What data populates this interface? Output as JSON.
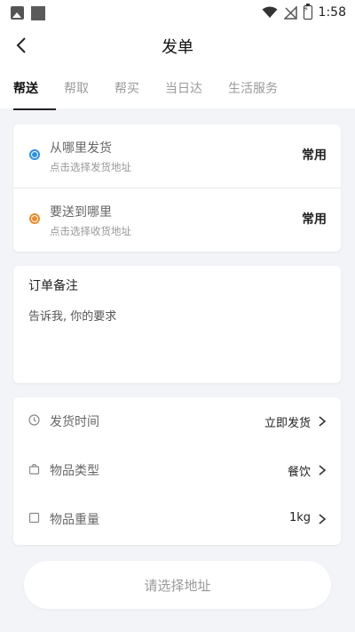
{
  "status_bar": {
    "time": "1:58"
  },
  "header": {
    "title": "发单"
  },
  "tabs": [
    {
      "label": "帮送",
      "active": true
    },
    {
      "label": "帮取",
      "active": false
    },
    {
      "label": "帮买",
      "active": false
    },
    {
      "label": "当日达",
      "active": false
    },
    {
      "label": "生活服务",
      "active": false
    }
  ],
  "addresses": {
    "from": {
      "title": "从哪里发货",
      "subtitle": "点击选择发货地址",
      "common_label": "常用",
      "dot_color": "#2c8fe6"
    },
    "to": {
      "title": "要送到哪里",
      "subtitle": "点击选择收货地址",
      "common_label": "常用",
      "dot_color": "#f08a2c"
    }
  },
  "note": {
    "title": "订单备注",
    "placeholder": "告诉我, 你的要求"
  },
  "info": {
    "time": {
      "label": "发货时间",
      "value": "立即发货",
      "icon": "clock-icon"
    },
    "type": {
      "label": "物品类型",
      "value": "餐饮",
      "icon": "bag-icon"
    },
    "weight": {
      "label": "物品重量",
      "value": "1kg",
      "icon": "square-icon"
    }
  },
  "submit": {
    "label": "请选择地址"
  }
}
